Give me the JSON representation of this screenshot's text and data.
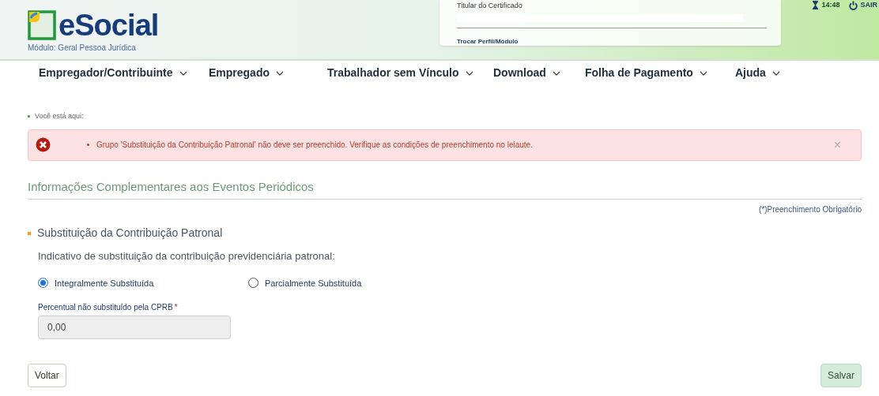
{
  "header": {
    "logo_text": "eSocial",
    "module": "Módulo: Geral Pessoa Jurídica",
    "certificate_label": "Titular do Certificado",
    "switch_profile": "Trocar Perfil/Módulo",
    "time": "14:48",
    "logout": "SAIR"
  },
  "nav": [
    {
      "label": "Empregador/Contribuinte"
    },
    {
      "label": "Empregado"
    },
    {
      "label": "Trabalhador sem Vínculo"
    },
    {
      "label": "Download"
    },
    {
      "label": "Folha de Pagamento"
    },
    {
      "label": "Ajuda"
    }
  ],
  "breadcrumb": "Você está aqui:",
  "alert": {
    "message": "Grupo 'Substituição da Contribuição Patronal' não deve ser preenchido. Verifique as condições de preenchimento no leiaute.",
    "close": "×"
  },
  "page_title": "Informações Complementares aos Eventos Periódicos",
  "required_note": "(*)Preenchimento Obrigatório",
  "section": {
    "title": "Substituição da Contribuição Patronal",
    "question": "Indicativo de substituição da contribuição previdenciária patronal:",
    "options": [
      {
        "label": "Integralmente Substituída",
        "selected": true
      },
      {
        "label": "Parcialmente Substituída",
        "selected": false
      }
    ],
    "field": {
      "label": "Percentual não substituído pela CPRB",
      "required_mark": "*",
      "value": "0,00",
      "disabled": true
    }
  },
  "buttons": [
    {
      "label": "Voltar",
      "kind": "secondary"
    },
    {
      "label": "Salvar",
      "kind": "primary"
    }
  ]
}
